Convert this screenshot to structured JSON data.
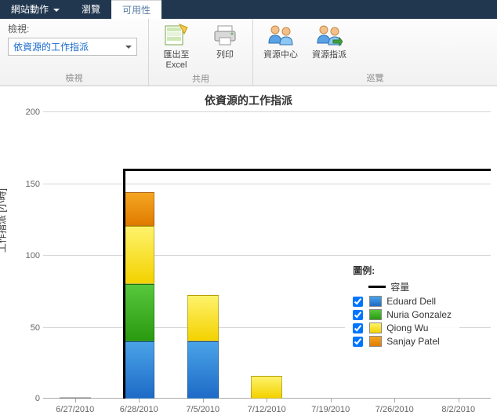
{
  "tabs": {
    "site_actions": "網站動作",
    "browse": "瀏覽",
    "availability": "可用性"
  },
  "ribbon": {
    "view_group_label": "檢視",
    "view_field_label": "檢視:",
    "view_selected": "依資源的工作指派",
    "share_group_label": "共用",
    "export_excel": "匯出至 Excel",
    "print": "列印",
    "navigate_group_label": "巡覽",
    "resource_center": "資源中心",
    "resource_assign": "資源指派"
  },
  "legend": {
    "title": "圖例:",
    "capacity": "容量",
    "s1": "Eduard Dell",
    "s2": "Nuria Gonzalez",
    "s3": "Qiong Wu",
    "s4": "Sanjay Patel"
  },
  "axes": {
    "y0": "0",
    "y50": "50",
    "y100": "100",
    "y150": "150",
    "y200": "200",
    "ylabel": "工作指派 [小時]"
  },
  "chart_data": {
    "type": "bar",
    "title": "依資源的工作指派",
    "ylabel": "工作指派 [小時]",
    "xlabel": "",
    "ylim": [
      0,
      200
    ],
    "categories": [
      "6/27/2010",
      "6/28/2010",
      "7/5/2010",
      "7/12/2010",
      "7/19/2010",
      "7/26/2010",
      "8/2/2010"
    ],
    "series": [
      {
        "name": "Eduard Dell",
        "color": "#2a7edc",
        "values": [
          1,
          40,
          40,
          0,
          0,
          0,
          0
        ]
      },
      {
        "name": "Nuria Gonzalez",
        "color": "#3fbf2a",
        "values": [
          0,
          40,
          0,
          0,
          0,
          0,
          0
        ]
      },
      {
        "name": "Qiong Wu",
        "color": "#f4e33a",
        "values": [
          0,
          40,
          32,
          16,
          0,
          0,
          0
        ]
      },
      {
        "name": "Sanjay Patel",
        "color": "#f09a1a",
        "values": [
          0,
          24,
          0,
          0,
          0,
          0,
          0
        ]
      }
    ],
    "capacity_line": {
      "name": "容量",
      "values": [
        0,
        160,
        160,
        160,
        160,
        160,
        160
      ]
    },
    "legend_position": "right"
  }
}
